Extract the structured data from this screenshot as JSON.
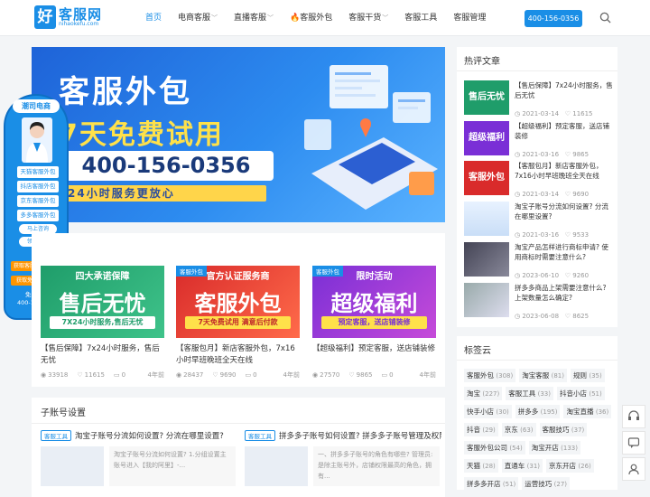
{
  "header": {
    "logo_badge": "好",
    "logo_name": "客服网",
    "logo_domain": "nihaokefu.com",
    "nav": [
      {
        "label": "首页",
        "active": true,
        "dropdown": false
      },
      {
        "label": "电商客服",
        "dropdown": true
      },
      {
        "label": "直播客服",
        "dropdown": true
      },
      {
        "label": "客服外包",
        "fire": true
      },
      {
        "label": "客服干货",
        "dropdown": true
      },
      {
        "label": "客服工具"
      },
      {
        "label": "客服管理"
      }
    ],
    "phone": "400-156-0356",
    "search_icon": "search-icon"
  },
  "banner": {
    "title": "客服外包",
    "subtitle": "7天免费试用",
    "phone": "400-156-0356",
    "tagline": "24小时服务更放心",
    "slides": 2,
    "active_slide": 1
  },
  "float_panel": {
    "header": "潮司电商",
    "buttons": [
      "天猫客服外包",
      "抖店客服外包",
      "京东客服外包",
      "多多客服外包"
    ],
    "chips": [
      "马上咨询",
      "领优惠卡"
    ],
    "offer1": "获取客服外包报价单",
    "offer2": "获取免费开店指导",
    "free_label": "免费热线:",
    "free_phone": "400-156-0356"
  },
  "cards": [
    {
      "top": "四大承诺保障",
      "big": "售后无忧",
      "strip": "7X24小时服务,售后无忧",
      "title": "【售后保障】7x24小时服务，售后无忧",
      "views": "33918",
      "likes": "11615",
      "comments": "0",
      "time": "4年前",
      "tag": ""
    },
    {
      "top": "官方认证服务商",
      "big": "客服外包",
      "strip": "7天免费试用 满意后付款",
      "title": "【客服包月】新店客服外包，7x16小时早班晚班全天在线",
      "views": "28437",
      "likes": "9690",
      "comments": "0",
      "time": "4年前",
      "tag": "客服外包"
    },
    {
      "top": "限时活动",
      "big": "超级福利",
      "strip": "预定客服，送店铺装修",
      "title": "【超级福利】预定客服，送店铺装修",
      "views": "27570",
      "likes": "9865",
      "comments": "0",
      "time": "4年前",
      "tag": "客服外包"
    }
  ],
  "zh": {
    "title": "子账号设置",
    "items": [
      {
        "tag": "客服工具",
        "title": "淘宝子账号分流如何设置? 分流在哪里设置?",
        "desc": "淘宝子账号分流如何设置? 1.分组设置主账号进入【我的阿里】-..."
      },
      {
        "tag": "客服工具",
        "title": "拼多多子账号如何设置? 拼多多子账号管理及权限...",
        "desc": "一、拼多多子账号的角色有哪些? 管理员: 是除主账号外，店铺权限最高的角色，拥有..."
      }
    ]
  },
  "hot": {
    "title": "热评文章",
    "items": [
      {
        "thumb": "售后无忧",
        "title": "【售后保障】7x24小时服务，售后无忧",
        "date": "2021-03-14",
        "count": "11615"
      },
      {
        "thumb": "超级福利",
        "title": "【超级福利】预定客服，送店铺装修",
        "date": "2021-03-16",
        "count": "9865"
      },
      {
        "thumb": "客服外包",
        "title": "【客服包月】新店客服外包，7x16小时早班晚班全天在线",
        "date": "2021-03-14",
        "count": "9690"
      },
      {
        "thumb": "",
        "title": "淘宝子账号分流如何设置? 分流在哪里设置?",
        "date": "2021-03-16",
        "count": "9533"
      },
      {
        "thumb": "",
        "title": "淘宝产品怎样进行商标申请? 使用商标时需要注意什么?",
        "date": "2023-06-10",
        "count": "9260"
      },
      {
        "thumb": "",
        "title": "拼多多商品上架需要注意什么? 上架数量怎么确定?",
        "date": "2023-06-08",
        "count": "8625"
      }
    ]
  },
  "tagcloud": {
    "title": "标签云",
    "tags": [
      {
        "name": "客服外包",
        "n": "(308)"
      },
      {
        "name": "淘宝客服",
        "n": "(81)"
      },
      {
        "name": "规则",
        "n": "(35)"
      },
      {
        "name": "淘宝",
        "n": "(227)"
      },
      {
        "name": "客服工具",
        "n": "(33)"
      },
      {
        "name": "抖音小店",
        "n": "(51)"
      },
      {
        "name": "快手小店",
        "n": "(30)"
      },
      {
        "name": "拼多多",
        "n": "(195)"
      },
      {
        "name": "淘宝直播",
        "n": "(36)"
      },
      {
        "name": "抖音",
        "n": "(29)"
      },
      {
        "name": "京东",
        "n": "(63)"
      },
      {
        "name": "客服技巧",
        "n": "(37)"
      },
      {
        "name": "客服外包公司",
        "n": "(54)"
      },
      {
        "name": "淘宝开店",
        "n": "(133)"
      },
      {
        "name": "天猫",
        "n": "(28)"
      },
      {
        "name": "直通车",
        "n": "(31)"
      },
      {
        "name": "京东开店",
        "n": "(26)"
      },
      {
        "name": "拼多多开店",
        "n": "(51)"
      },
      {
        "name": "运营技巧",
        "n": "(27)"
      }
    ]
  },
  "colors": {
    "brand": "#1a8ee6",
    "accent": "#ff9500"
  }
}
